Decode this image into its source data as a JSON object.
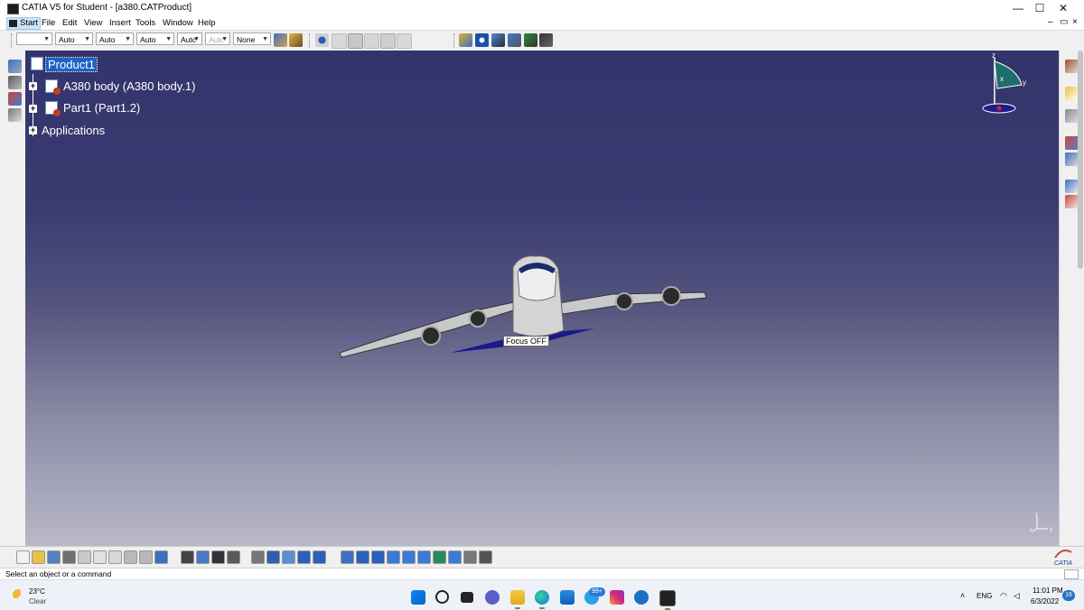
{
  "window": {
    "title": "CATIA V5 for Student - [a380.CATProduct]",
    "controls": {
      "minimize": "—",
      "maximize": "☐",
      "close": "✕"
    }
  },
  "menu": {
    "items": [
      "Start",
      "File",
      "Edit",
      "View",
      "Insert",
      "Tools",
      "Window",
      "Help"
    ],
    "mdi_controls": {
      "minimize": "–",
      "restore": "▭",
      "close": "×"
    }
  },
  "toolbar_top": {
    "combos": [
      "",
      "Auto",
      "Auto",
      "Auto",
      "Autc",
      "Autc",
      "None"
    ],
    "icons": [
      "painter-icon",
      "brush-icon",
      "constraint-icon",
      "catalog-icon",
      "snapshot-icon",
      "zoom-area-icon",
      "mouse-icon",
      "sketch-icon",
      "product-icon",
      "web-icon",
      "tree-icon",
      "assembly-icon",
      "structure-icon"
    ]
  },
  "tree": {
    "root": "Product1",
    "children": [
      "A380 body (A380 body.1)",
      "Part1 (Part1.2)",
      "Applications"
    ]
  },
  "viewport": {
    "focus_label": "Focus OFF",
    "compass_axes": {
      "z": "z",
      "x": "x",
      "y": "y"
    },
    "axis_triad": {
      "z": "z",
      "x": "x",
      "y": "y"
    },
    "catia_logo": "CATIA"
  },
  "toolbar_bottom": {
    "icons": [
      "new-icon",
      "open-icon",
      "save-icon",
      "print-icon",
      "cut-icon",
      "copy-icon",
      "paste-icon",
      "undo-icon",
      "redo-icon",
      "whats-this-icon",
      "formula-icon",
      "comment-icon",
      "table-icon",
      "dimension-icon",
      "view-icon",
      "measure-icon",
      "fly-icon",
      "fit-all-icon",
      "pan-icon",
      "rotate-icon",
      "zoom-in-icon",
      "zoom-out-icon",
      "normal-view-icon",
      "iso-view-icon",
      "hide-show-icon",
      "swap-icon",
      "render-icon",
      "grid-icon",
      "capture-icon"
    ]
  },
  "status": {
    "message": "Select an object or a command"
  },
  "taskbar": {
    "weather_temp": "23°C",
    "weather_desc": "Clear",
    "apps": [
      "start-icon",
      "search-icon",
      "task-view-icon",
      "chat-icon",
      "file-explorer-icon",
      "edge-icon",
      "store-icon",
      "telegram-icon",
      "instagram-icon",
      "shield-icon",
      "catia-icon"
    ],
    "telegram_badge": "99+",
    "lang": "ENG",
    "time": "11:01 PM",
    "date": "6/3/2022",
    "notifications": "16",
    "colors": {
      "accent": "#0067c0",
      "tree_highlight": "#1d63c7",
      "viewport_top": "#34346c",
      "viewport_bottom": "#b9b9c8"
    }
  }
}
